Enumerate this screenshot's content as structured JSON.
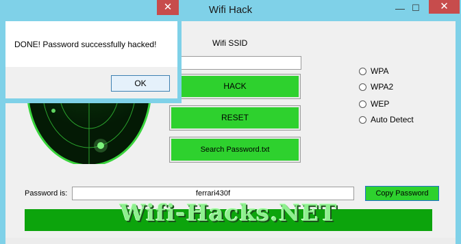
{
  "main_window": {
    "title": "Wifi Hack",
    "close_glyph": "✕",
    "minimize_glyph": "—",
    "maximize_glyph": "☐"
  },
  "ssid": {
    "label": "Wifi SSID",
    "value": ""
  },
  "buttons": {
    "hack": "HACK",
    "reset": "RESET",
    "search": "Search Password.txt",
    "copy": "Copy Password"
  },
  "encryption_options": [
    "WPA",
    "WPA2",
    "WEP",
    "Auto Detect"
  ],
  "password": {
    "label": "Password is:",
    "value": "ferrari430f"
  },
  "banner": {
    "text": "Wifi-Hacks.NET"
  },
  "message_box": {
    "message": "DONE! Password successfully hacked!",
    "ok_label": "OK",
    "close_glyph": "✕"
  },
  "colors": {
    "button_green": "#2ed12e",
    "banner_green": "#0ca40c",
    "title_bar": "#7fd1e8",
    "close_red": "#c74c4c"
  },
  "icons": [
    "radar-icon",
    "close-icon",
    "minimize-icon",
    "maximize-icon"
  ]
}
